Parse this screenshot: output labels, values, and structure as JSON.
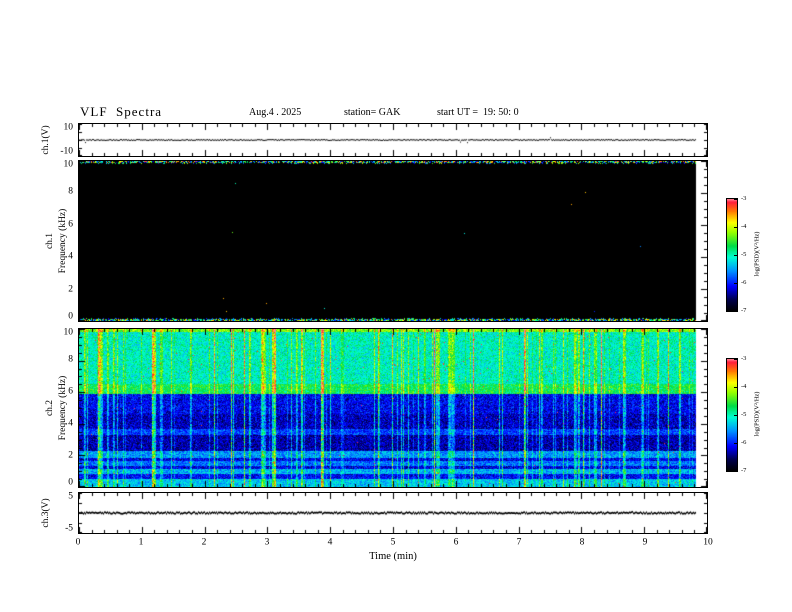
{
  "header": {
    "title": "VLF  Spectra",
    "date": "Aug.4 . 2025",
    "station": "station= GAK",
    "start_ut": "start UT =  19: 50: 0"
  },
  "xaxis": {
    "label": "Time (min)",
    "ticks": [
      0,
      1,
      2,
      3,
      4,
      5,
      6,
      7,
      8,
      9,
      10
    ],
    "lim": [
      0,
      10
    ],
    "minor_tick_step": 0.2,
    "data_end_min": 9.82
  },
  "colorbar": {
    "label": "log(PSD)(V²/Hz)",
    "ticks": [
      -3,
      -4,
      -5,
      -6,
      -7
    ],
    "lim": [
      -7,
      -3
    ]
  },
  "palette": {
    "stops": [
      [
        0.0,
        "#000000"
      ],
      [
        0.1,
        "#00004b"
      ],
      [
        0.22,
        "#0000ff"
      ],
      [
        0.36,
        "#0096ff"
      ],
      [
        0.48,
        "#00ffd2"
      ],
      [
        0.58,
        "#00dc46"
      ],
      [
        0.7,
        "#96ff00"
      ],
      [
        0.79,
        "#ffff00"
      ],
      [
        0.89,
        "#ff7800"
      ],
      [
        0.97,
        "#ff1e3c"
      ],
      [
        1.0,
        "#ff8296"
      ]
    ]
  },
  "chart_data": [
    {
      "id": "ch1-voltage",
      "type": "line",
      "ylabel": "ch.1(V)",
      "ylim": [
        -10,
        10
      ],
      "yticks": [
        10,
        -10
      ],
      "value_v": 0,
      "series_desc": "flat trace at ~0 V for the full 0-9.8 min record, tiny noise blips only"
    },
    {
      "id": "ch1-spectrogram",
      "type": "heatmap",
      "ylabel_lines": [
        "ch.1",
        "Frequency (kHz)"
      ],
      "ylim": [
        0,
        10
      ],
      "yticks": [
        0,
        2,
        4,
        6,
        8,
        10
      ],
      "psd_lim": [
        -7,
        -3
      ],
      "description": "no broadband signal: power at noise floor (log PSD <= -7, solid black) over 0-10 kHz for the whole record; thin speckled rows of elevated PSD only along the 0 kHz and 10 kHz edges"
    },
    {
      "id": "ch2-spectrogram",
      "type": "heatmap",
      "ylabel_lines": [
        "ch.2",
        "Frequency (kHz)"
      ],
      "ylim": [
        0,
        10
      ],
      "yticks": [
        0,
        2,
        4,
        6,
        8,
        10
      ],
      "psd_lim": [
        -7,
        -3
      ],
      "description": "broadband VLF activity: mottled green/cyan band (~ -5) above ~6.5 kHz with a brighter green band at 6-6.5 kHz; darker blue region (~ -6.3) between 2.5 and 6 kHz; cyan horizontal hum bands near 1, 1.5 and 2 kHz; bright speckle rows at 0 and 10 kHz edges; dense vertical sferic streaks spanning all frequencies with sparse red impulses (~ -3)"
    },
    {
      "id": "ch3-voltage",
      "type": "line",
      "ylabel": "ch.3(V)",
      "ylim": [
        -5,
        5
      ],
      "yticks": [
        5,
        -5
      ],
      "value_v": 0,
      "series_desc": "flat dark trace at ~0 V for the full 0-9.8 min record"
    }
  ]
}
